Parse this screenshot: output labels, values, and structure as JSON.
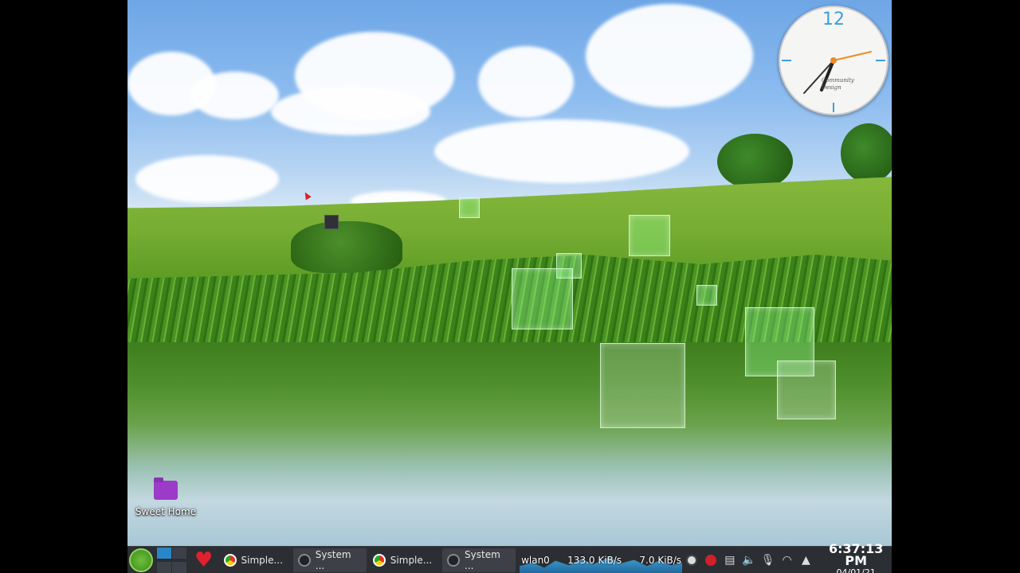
{
  "desktop": {
    "icon_label": "Sweet Home"
  },
  "clock_widget": {
    "hour_marker": "12",
    "brand_line1": "Community",
    "brand_line2": "Design"
  },
  "taskbar": {
    "tasks": [
      {
        "label": "Simple...",
        "icon": "chrome-icon"
      },
      {
        "label": "System ...",
        "icon": "terminal-icon"
      },
      {
        "label": "Simple...",
        "icon": "chrome-icon"
      },
      {
        "label": "System ...",
        "icon": "terminal-icon"
      }
    ],
    "network": {
      "interface": "wlan0",
      "down": "133.0 KiB/s",
      "up": "7.0 KiB/s"
    },
    "time": "6:37:13 PM",
    "date": "04/01/21"
  }
}
